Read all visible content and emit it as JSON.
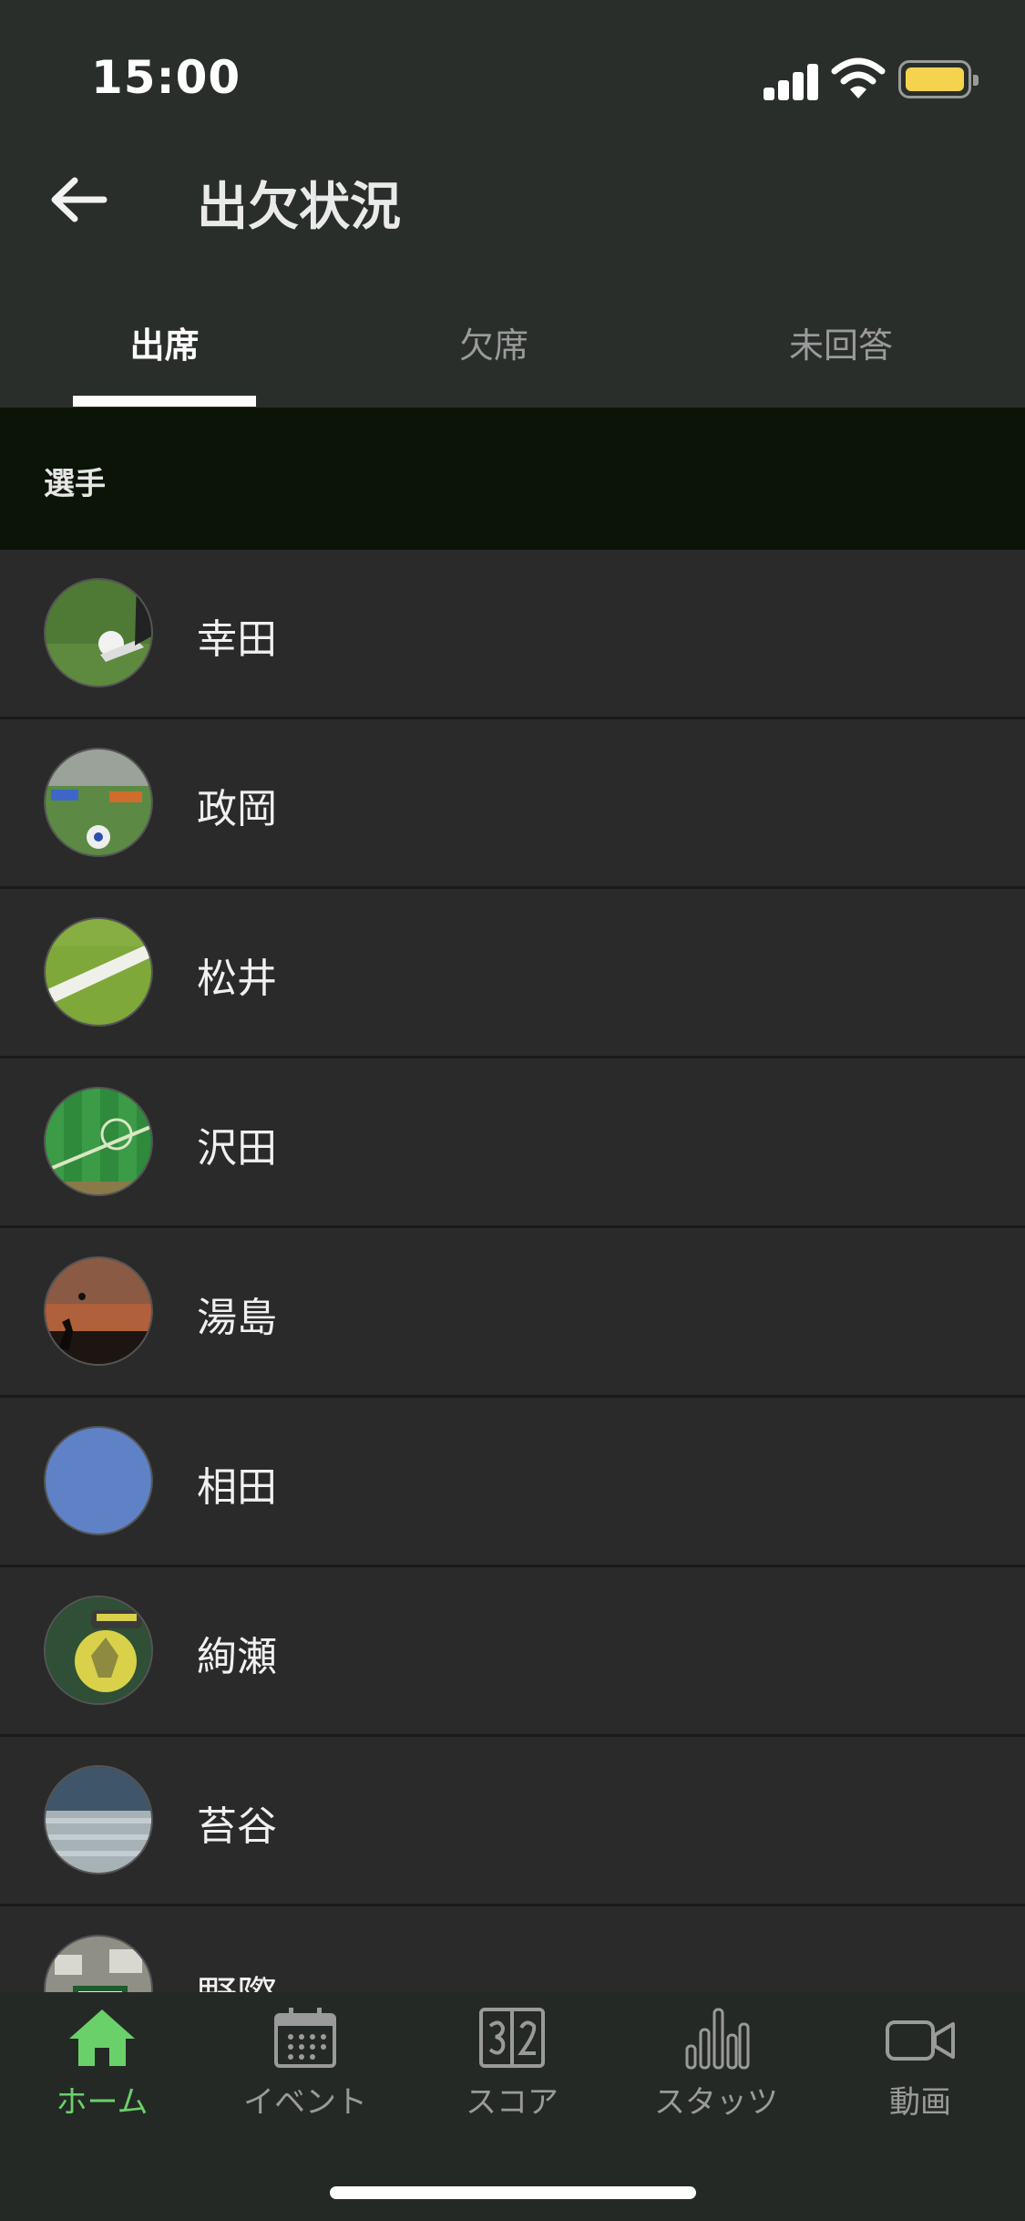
{
  "status_bar": {
    "time": "15:00"
  },
  "header": {
    "title": "出欠状況",
    "back_icon": "arrow-left-icon"
  },
  "tabs": [
    {
      "label": "出席",
      "active": true
    },
    {
      "label": "欠席",
      "active": false
    },
    {
      "label": "未回答",
      "active": false
    }
  ],
  "section": {
    "label": "選手"
  },
  "players": [
    {
      "name": "幸田"
    },
    {
      "name": "政岡"
    },
    {
      "name": "松井"
    },
    {
      "name": "沢田"
    },
    {
      "name": "湯島"
    },
    {
      "name": "相田"
    },
    {
      "name": "絢瀬"
    },
    {
      "name": "苔谷"
    },
    {
      "name": "野際"
    }
  ],
  "bottom_nav": [
    {
      "label": "ホーム",
      "icon": "home-icon",
      "active": true
    },
    {
      "label": "イベント",
      "icon": "calendar-icon",
      "active": false
    },
    {
      "label": "スコア",
      "icon": "scoreboard-icon",
      "active": false
    },
    {
      "label": "スタッツ",
      "icon": "bar-chart-icon",
      "active": false
    },
    {
      "label": "動画",
      "icon": "video-camera-icon",
      "active": false
    }
  ],
  "colors": {
    "accent": "#6ad16a",
    "section_bg": "#0c1407",
    "battery": "#f5d34f"
  }
}
